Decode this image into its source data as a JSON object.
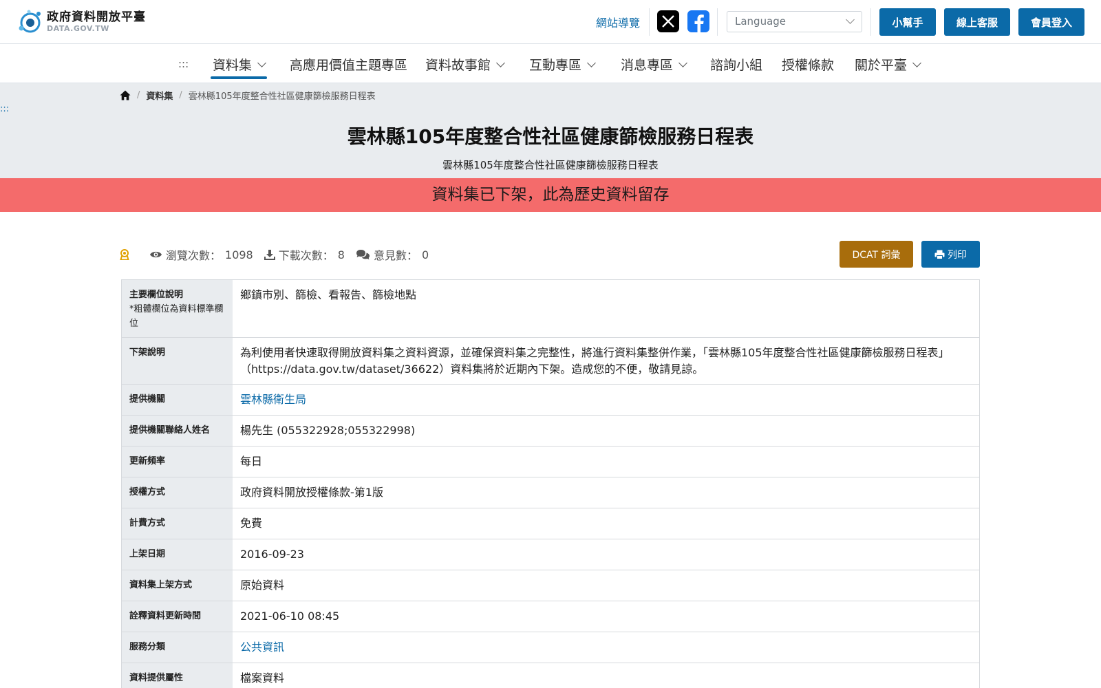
{
  "header": {
    "logo_title": "政府資料開放平臺",
    "logo_sub": "DATA.GOV.TW",
    "sitemap": "網站導覽",
    "language_placeholder": "Language",
    "btn_helper": "小幫手",
    "btn_service": "線上客服",
    "btn_login": "會員登入"
  },
  "nav": {
    "accesskey": ":::",
    "items": [
      "資料集",
      "高應用價值主題專區",
      "資料故事館",
      "互動專區",
      "消息專區",
      "諮詢小組",
      "授權條款",
      "關於平臺"
    ]
  },
  "breadcrumb": {
    "items": [
      "資料集",
      "雲林縣105年度整合性社區健康篩檢服務日程表"
    ]
  },
  "accesskey2": ":::",
  "page": {
    "title": "雲林縣105年度整合性社區健康篩檢服務日程表",
    "subtitle": "雲林縣105年度整合性社區健康篩檢服務日程表",
    "alert": "資料集已下架，此為歷史資料留存"
  },
  "stats": {
    "views_label": "瀏覽次數：",
    "views": "1098",
    "downloads_label": "下載次數：",
    "downloads": "8",
    "comments_label": "意見數：",
    "comments": "0"
  },
  "actions": {
    "dcat": "DCAT 詞彙",
    "print": "列印"
  },
  "table": {
    "rows": [
      {
        "key": "主要欄位說明",
        "note": "*粗體欄位為資料標準欄位",
        "value": "鄉鎮市別、篩檢、看報告、篩檢地點"
      },
      {
        "key": "下架說明",
        "value": "為利使用者快速取得開放資料集之資料資源，並確保資料集之完整性，將進行資料集整併作業，「雲林縣105年度整合性社區健康篩檢服務日程表」（https://data.gov.tw/dataset/36622）資料集將於近期內下架。造成您的不便，敬請見諒。"
      },
      {
        "key": "提供機關",
        "value": "雲林縣衛生局"
      },
      {
        "key": "提供機關聯絡人姓名",
        "value": "楊先生 (055322928;055322998)"
      },
      {
        "key": "更新頻率",
        "value": "每日"
      },
      {
        "key": "授權方式",
        "value": "政府資料開放授權條款-第1版"
      },
      {
        "key": "計費方式",
        "value": "免費"
      },
      {
        "key": "上架日期",
        "value": "2016-09-23"
      },
      {
        "key": "資料集上架方式",
        "value": "原始資料"
      },
      {
        "key": "詮釋資料更新時間",
        "value": "2021-06-10 08:45"
      },
      {
        "key": "服務分類",
        "value": "公共資訊"
      },
      {
        "key": "資料提供屬性",
        "value": "檔案資料"
      }
    ]
  },
  "colors": {
    "primary": "#0b6aa8",
    "alert": "#f46b6b",
    "dcat": "#a86d0c",
    "band": "#e9ecef"
  }
}
